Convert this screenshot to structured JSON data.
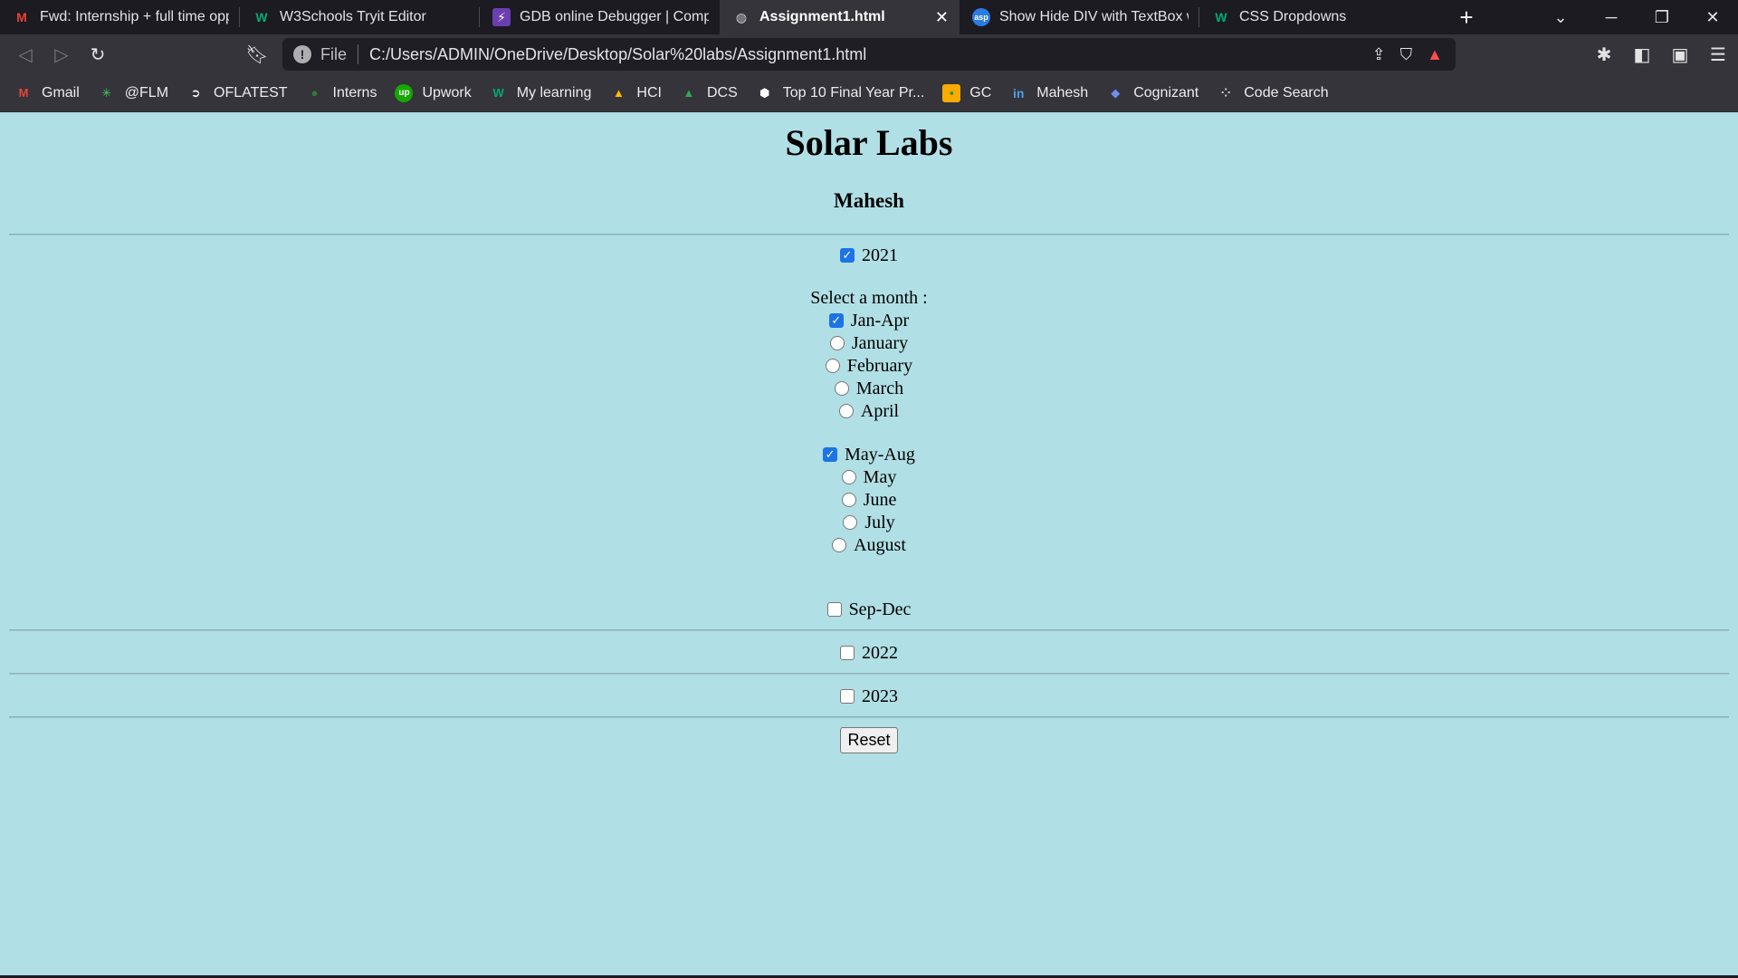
{
  "browser": {
    "tabs": [
      {
        "title": "Fwd: Internship + full time oppor",
        "icon": "gmail-icon",
        "active": false
      },
      {
        "title": "W3Schools Tryit Editor",
        "icon": "w3schools-icon",
        "active": false
      },
      {
        "title": "GDB online Debugger | Compiler",
        "icon": "gdb-icon",
        "active": false
      },
      {
        "title": "Assignment1.html",
        "icon": "globe-icon",
        "active": true
      },
      {
        "title": "Show Hide DIV with TextBox whe",
        "icon": "aspsnippets-icon",
        "active": false
      },
      {
        "title": "CSS Dropdowns",
        "icon": "w3schools-icon",
        "active": false
      }
    ],
    "url_scheme": "File",
    "url": "C:/Users/ADMIN/OneDrive/Desktop/Solar%20labs/Assignment1.html",
    "bookmarks": [
      {
        "label": "Gmail",
        "icon": "gmail-icon"
      },
      {
        "label": "@FLM",
        "icon": "flm-icon"
      },
      {
        "label": "OFLATEST",
        "icon": "oflatest-icon"
      },
      {
        "label": "Interns",
        "icon": "interns-icon"
      },
      {
        "label": "Upwork",
        "icon": "upwork-icon"
      },
      {
        "label": "My learning",
        "icon": "w3schools-icon"
      },
      {
        "label": "HCI",
        "icon": "drive-icon"
      },
      {
        "label": "DCS",
        "icon": "drive-icon"
      },
      {
        "label": "Top 10 Final Year Pr...",
        "icon": "project-icon"
      },
      {
        "label": "GC",
        "icon": "classroom-icon"
      },
      {
        "label": "Mahesh",
        "icon": "linkedin-icon"
      },
      {
        "label": "Cognizant",
        "icon": "cognizant-icon"
      },
      {
        "label": "Code Search",
        "icon": "codesearch-icon"
      }
    ]
  },
  "page": {
    "title": "Solar Labs",
    "subtitle": "Mahesh",
    "year_2021": {
      "label": "2021",
      "checked": true
    },
    "month_prompt": "Select a month :",
    "group_jan_apr": {
      "label": "Jan-Apr",
      "checked": true,
      "months": [
        "January",
        "February",
        "March",
        "April"
      ]
    },
    "group_may_aug": {
      "label": "May-Aug",
      "checked": true,
      "months": [
        "May",
        "June",
        "July",
        "August"
      ]
    },
    "group_sep_dec": {
      "label": "Sep-Dec",
      "checked": false
    },
    "year_2022": {
      "label": "2022",
      "checked": false
    },
    "year_2023": {
      "label": "2023",
      "checked": false
    },
    "reset_label": "Reset"
  },
  "colors": {
    "page_background": "#b0dfe5",
    "checkbox_checked": "#1d74e6",
    "chrome_dark": "#1c1b22",
    "chrome_toolbar": "#35343a"
  }
}
